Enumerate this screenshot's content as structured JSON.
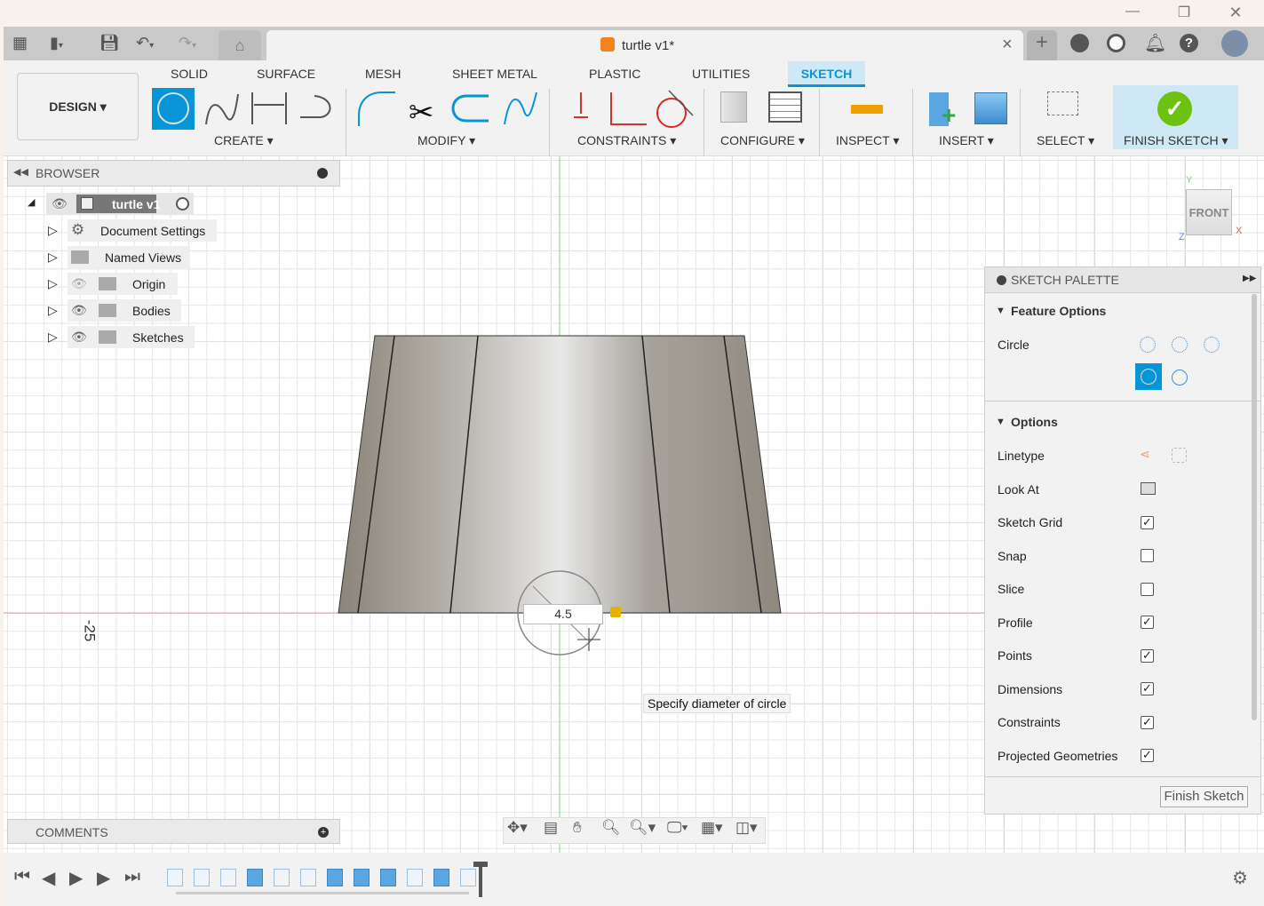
{
  "window": {
    "minimize": "—",
    "restore": "❐",
    "close": "✕"
  },
  "quick_access": {
    "grid_icon": "apps",
    "file_icon": "file",
    "save_icon": "save",
    "undo_icon": "undo",
    "redo_icon": "redo",
    "home_icon": "home"
  },
  "doc_tab": {
    "title": "turtle v1*",
    "close": "×"
  },
  "top_right_icons": [
    "add",
    "extensions",
    "job-status",
    "notifications",
    "help",
    "profile"
  ],
  "workspace": {
    "label": "DESIGN ▾"
  },
  "ribbon_tabs": [
    "SOLID",
    "SURFACE",
    "MESH",
    "SHEET METAL",
    "PLASTIC",
    "UTILITIES",
    "SKETCH"
  ],
  "active_tab": "SKETCH",
  "groups": {
    "create": "CREATE ▾",
    "modify": "MODIFY ▾",
    "constraints": "CONSTRAINTS ▾",
    "configure": "CONFIGURE ▾",
    "inspect": "INSPECT ▾",
    "insert": "INSERT ▾",
    "select": "SELECT ▾",
    "finish": "FINISH SKETCH ▾"
  },
  "browser": {
    "title": "BROWSER",
    "root": "turtle v1",
    "items": [
      "Document Settings",
      "Named Views",
      "Origin",
      "Bodies",
      "Sketches"
    ]
  },
  "comments": {
    "title": "COMMENTS"
  },
  "canvas": {
    "dimension_value": "4.5",
    "axis_label": "-25",
    "tooltip": "Specify diameter of circle",
    "viewcube": "FRONT",
    "axis_x": "X",
    "axis_y": "Y",
    "axis_z": "Z"
  },
  "palette": {
    "title": "SKETCH PALETTE",
    "feature_options": "Feature Options",
    "circle_label": "Circle",
    "options": "Options",
    "rows": [
      {
        "label": "Linetype",
        "type": "icons"
      },
      {
        "label": "Look At",
        "type": "icon"
      },
      {
        "label": "Sketch Grid",
        "checked": true
      },
      {
        "label": "Snap",
        "checked": false
      },
      {
        "label": "Slice",
        "checked": false
      },
      {
        "label": "Profile",
        "checked": true
      },
      {
        "label": "Points",
        "checked": true
      },
      {
        "label": "Dimensions",
        "checked": true
      },
      {
        "label": "Constraints",
        "checked": true
      },
      {
        "label": "Projected Geometries",
        "checked": true
      }
    ],
    "finish_button": "Finish Sketch"
  },
  "colors": {
    "accent": "#0696d7",
    "finish_green": "#6cc20e",
    "x_axis": "#e06666",
    "y_axis": "#5cc85c"
  }
}
